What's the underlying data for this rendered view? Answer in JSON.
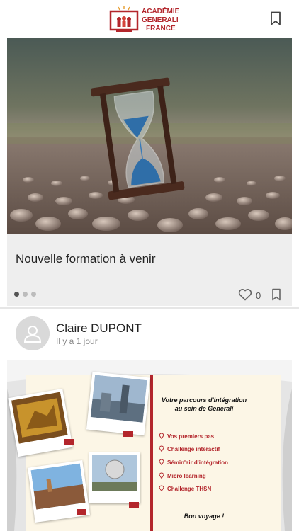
{
  "header": {
    "logo_text": [
      "ACADÉMIE",
      "GENERALI",
      "FRANCE"
    ],
    "brand_color": "#b3262c"
  },
  "feed": {
    "card1": {
      "title": "Nouvelle formation à venir",
      "carousel_count": 3,
      "carousel_active": 1,
      "likes": "0"
    },
    "author": {
      "name": "Claire DUPONT",
      "time": "Il y a 1 jour"
    },
    "card2": {
      "title_line1": "Votre parcours d'intégration",
      "title_line2": "au sein de Generali",
      "items": [
        "Vos premiers pas",
        "Challenge interactif",
        "Sémin'air d'intégration",
        "Micro learning",
        "Challenge THSN"
      ],
      "footer": "Bon voyage !"
    }
  }
}
